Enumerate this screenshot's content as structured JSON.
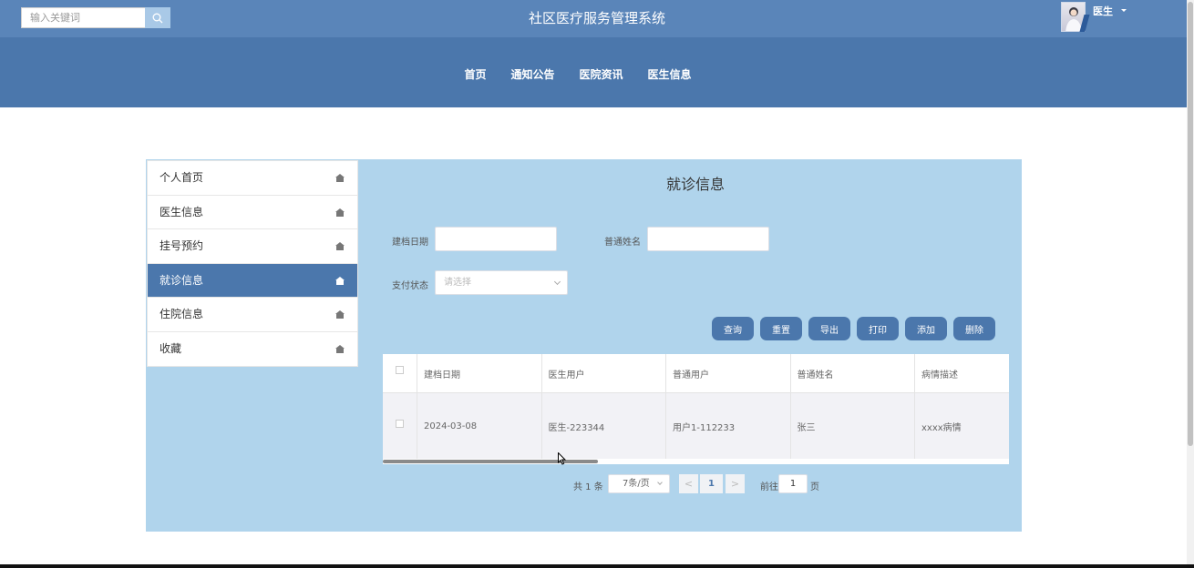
{
  "search": {
    "placeholder": "输入关键词",
    "icon": "search-icon"
  },
  "header": {
    "title": "社区医疗服务管理系统",
    "user": "医生"
  },
  "nav": {
    "items": [
      "首页",
      "通知公告",
      "医院资讯",
      "医生信息"
    ]
  },
  "sidebar": {
    "items": [
      {
        "label": "个人首页",
        "active": false
      },
      {
        "label": "医生信息",
        "active": false
      },
      {
        "label": "挂号预约",
        "active": false
      },
      {
        "label": "就诊信息",
        "active": true
      },
      {
        "label": "住院信息",
        "active": false
      },
      {
        "label": "收藏",
        "active": false
      }
    ]
  },
  "main": {
    "title": "就诊信息",
    "filters": {
      "date_label": "建档日期",
      "date_value": "",
      "name_label": "普通姓名",
      "name_value": "",
      "pay_label": "支付状态",
      "pay_placeholder": "请选择"
    },
    "actions": [
      "查询",
      "重置",
      "导出",
      "打印",
      "添加",
      "删除"
    ],
    "table": {
      "columns": [
        "建档日期",
        "医生用户",
        "普通用户",
        "普通姓名",
        "病情描述"
      ],
      "rows": [
        [
          "2024-03-08",
          "医生-223344",
          "用户1-112233",
          "张三",
          "xxxx病情"
        ]
      ]
    },
    "pagination": {
      "total": "共 1 条",
      "page_size": "7条/页",
      "prev": "<",
      "current": "1",
      "next": ">",
      "goto_label": "前往",
      "goto_value": "1",
      "goto_unit": "页"
    }
  },
  "colors": {
    "header": "#5a85b9",
    "nav": "#4b77ac",
    "panel": "#b0d4ec",
    "accent": "#4b77ac"
  }
}
